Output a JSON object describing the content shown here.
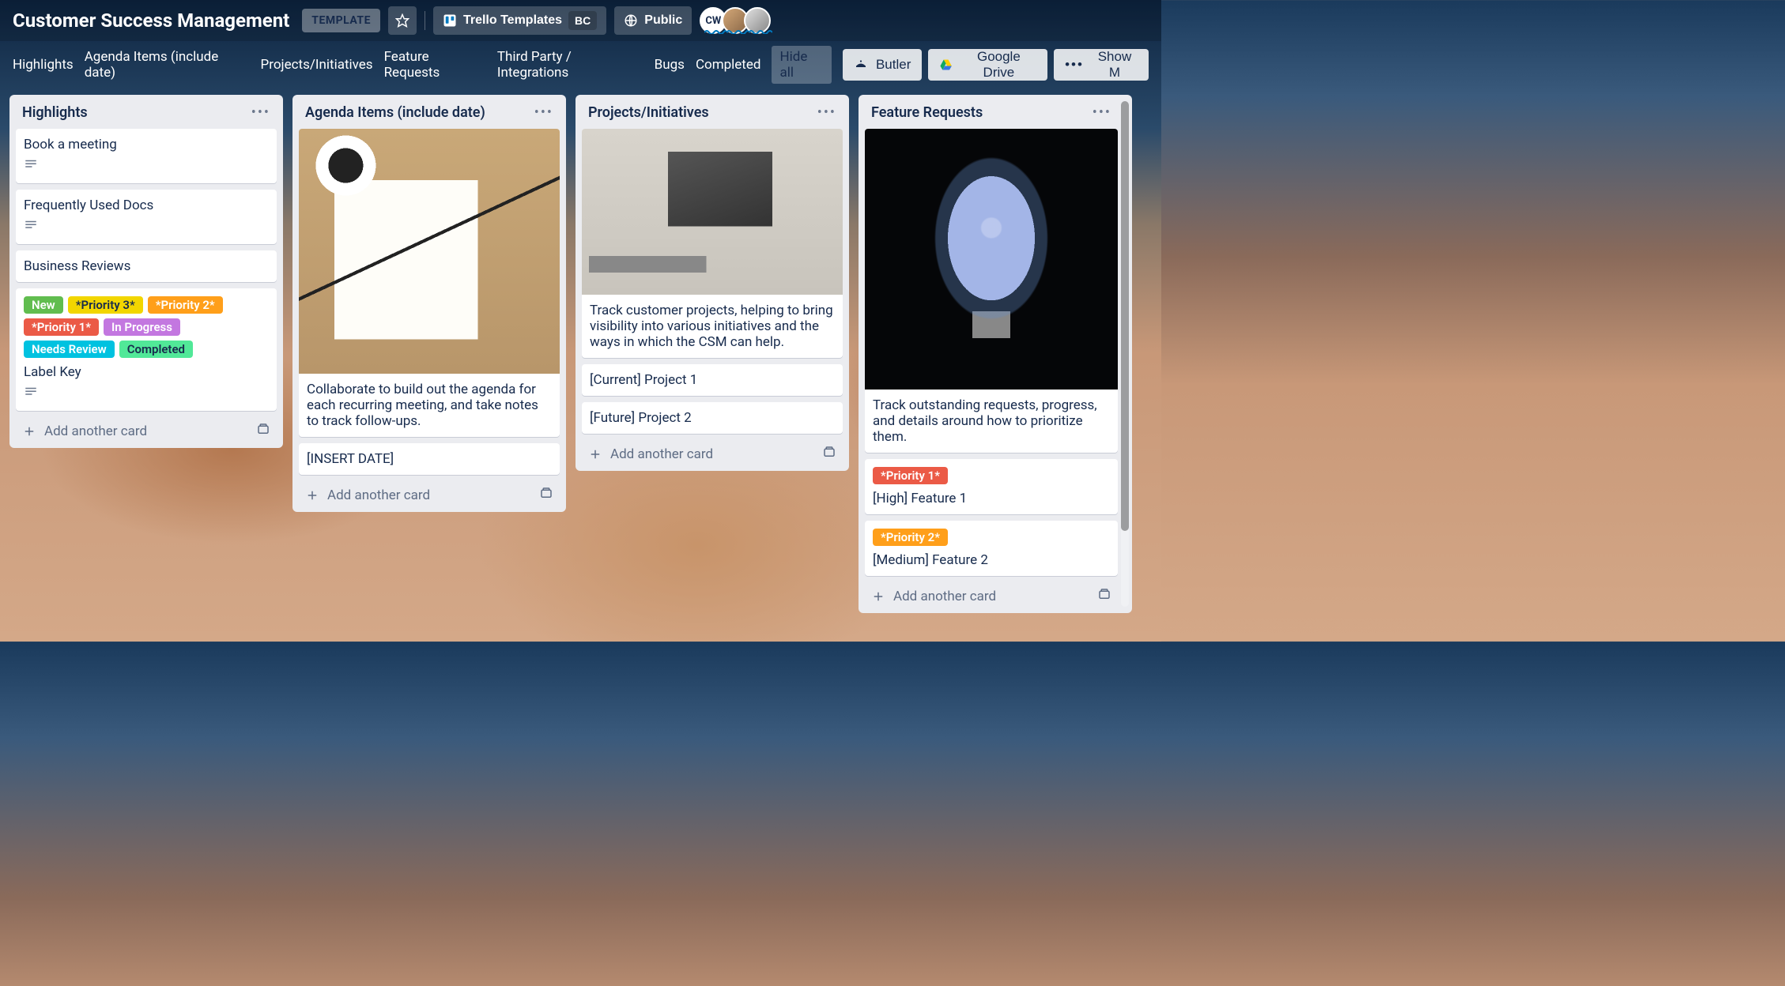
{
  "header": {
    "board_title": "Customer Success Management",
    "template_badge": "TEMPLATE",
    "workspace_name": "Trello Templates",
    "workspace_initials": "BC",
    "visibility": "Public",
    "avatars": [
      {
        "initials": "CW"
      },
      {
        "initials": ""
      },
      {
        "initials": ""
      }
    ]
  },
  "filters": {
    "items": [
      "Highlights",
      "Agenda Items (include date)",
      "Projects/Initiatives",
      "Feature Requests",
      "Third Party / Integrations",
      "Bugs",
      "Completed"
    ],
    "hide_all": "Hide all"
  },
  "powerups": {
    "butler": "Butler",
    "gdrive": "Google Drive",
    "show_menu": "Show M"
  },
  "labels": {
    "new": "New",
    "p3": "*Priority 3*",
    "p2": "*Priority 2*",
    "p1": "*Priority 1*",
    "inprogress": "In Progress",
    "needsreview": "Needs Review",
    "completed": "Completed"
  },
  "lists": [
    {
      "title": "Highlights",
      "add_label": "Add another card",
      "cards": [
        {
          "title": "Book a meeting",
          "has_desc": true
        },
        {
          "title": "Frequently Used Docs",
          "has_desc": true
        },
        {
          "title": "Business Reviews"
        },
        {
          "title": "Label Key",
          "has_desc": true,
          "show_all_labels": true
        }
      ]
    },
    {
      "title": "Agenda Items (include date)",
      "add_label": "Add another card",
      "cards": [
        {
          "title": "Collaborate to build out the agenda for each recurring meeting, and take notes to track follow-ups.",
          "cover": "agenda"
        },
        {
          "title": "[INSERT DATE]"
        }
      ]
    },
    {
      "title": "Projects/Initiatives",
      "add_label": "Add another card",
      "cards": [
        {
          "title": "Track customer projects, helping to bring visibility into various initiatives and the ways in which the CSM can help.",
          "cover": "projects"
        },
        {
          "title": "[Current] Project 1"
        },
        {
          "title": "[Future] Project 2"
        }
      ]
    },
    {
      "title": "Feature Requests",
      "add_label": "Add another card",
      "cards": [
        {
          "title": "Track outstanding requests, progress, and details around how to prioritize them.",
          "cover": "bulb"
        },
        {
          "title": "[High] Feature 1",
          "labels": [
            "p1"
          ]
        },
        {
          "title": "[Medium] Feature 2",
          "labels": [
            "p2"
          ]
        }
      ]
    }
  ]
}
